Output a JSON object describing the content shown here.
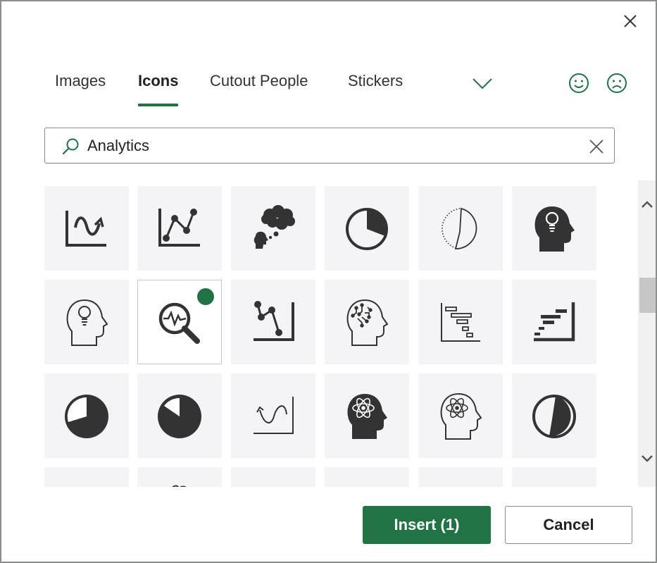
{
  "dialog": {
    "close_icon": "close-icon",
    "accent_color": "#217346"
  },
  "tabs": [
    {
      "label": "Images",
      "active": false
    },
    {
      "label": "Icons",
      "active": true
    },
    {
      "label": "Cutout People",
      "active": false
    },
    {
      "label": "Stickers",
      "active": false
    }
  ],
  "more_tabs_icon": "chevron-down-icon",
  "feedback": {
    "like_icon": "smiley-face-icon",
    "dislike_icon": "frowning-face-icon"
  },
  "search": {
    "value": "Analytics",
    "icon": "search-icon",
    "clear_icon": "clear-icon"
  },
  "icons": [
    {
      "name": "line-chart-wave-arrow",
      "selected": false
    },
    {
      "name": "line-chart-points",
      "selected": false
    },
    {
      "name": "head-thought-cloud",
      "selected": false
    },
    {
      "name": "pie-chart-quarter",
      "selected": false
    },
    {
      "name": "pie-chart-dotted",
      "selected": false
    },
    {
      "name": "head-lightbulb-filled",
      "selected": false
    },
    {
      "name": "head-lightbulb-outline",
      "selected": false
    },
    {
      "name": "magnifier-pulse",
      "selected": true
    },
    {
      "name": "line-chart-descending",
      "selected": false
    },
    {
      "name": "head-circuit",
      "selected": false
    },
    {
      "name": "gantt-chart-outline",
      "selected": false
    },
    {
      "name": "gantt-chart-filled",
      "selected": false
    },
    {
      "name": "pie-chart-three-quarter",
      "selected": false
    },
    {
      "name": "pie-chart-seven-eighths",
      "selected": false
    },
    {
      "name": "line-chart-wave-reverse",
      "selected": false
    },
    {
      "name": "head-atom-filled",
      "selected": false
    },
    {
      "name": "head-atom-outline",
      "selected": false
    },
    {
      "name": "pie-chart-half",
      "selected": false
    }
  ],
  "selected_count": 1,
  "buttons": {
    "insert_label": "Insert (1)",
    "cancel_label": "Cancel"
  }
}
